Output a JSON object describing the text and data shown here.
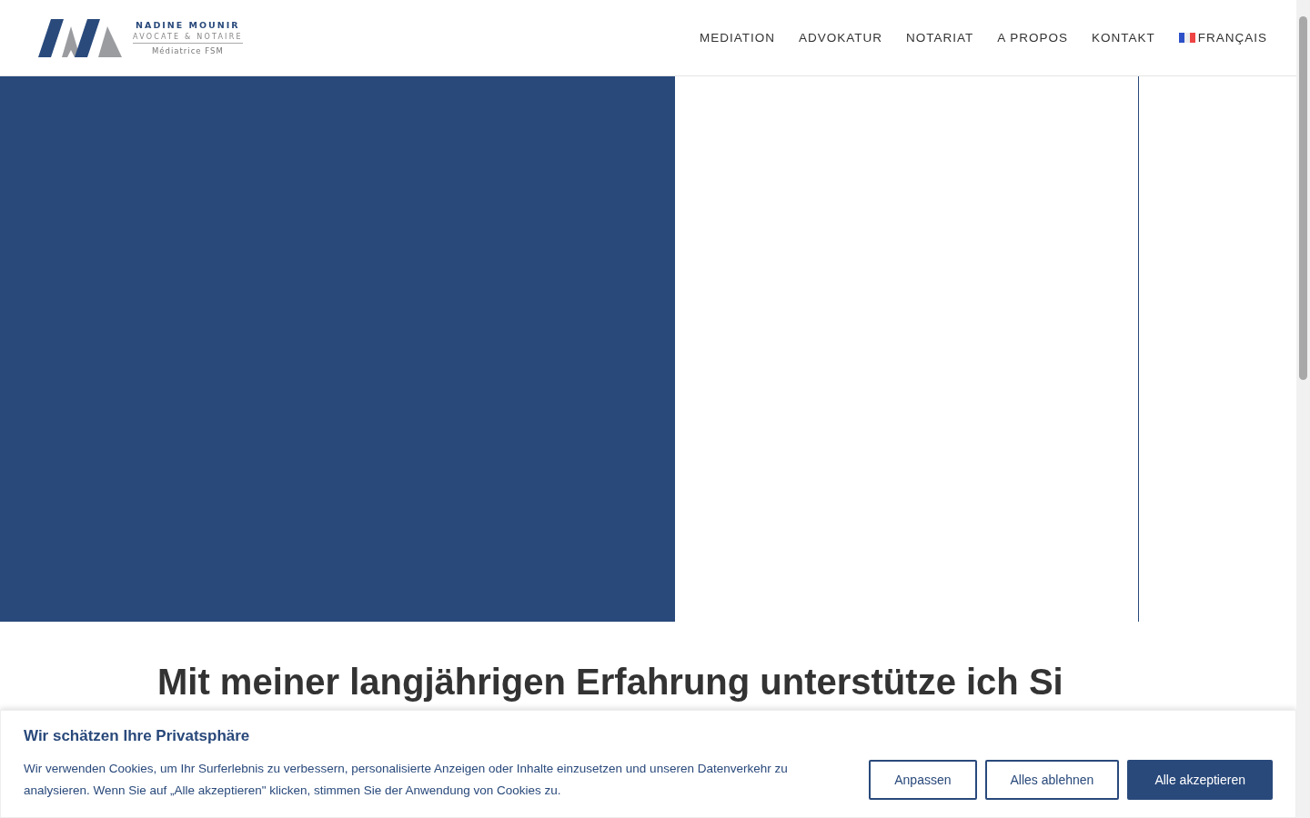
{
  "header": {
    "logo": {
      "name": "NADINE MOUNIR",
      "subtitle": "AVOCATE & NOTAIRE",
      "tagline": "Médiatrice FSM"
    },
    "nav": [
      {
        "label": "MEDIATION",
        "kind": "link"
      },
      {
        "label": "ADVOKATUR",
        "kind": "link"
      },
      {
        "label": "NOTARIAT",
        "kind": "link"
      },
      {
        "label": "A PROPOS",
        "kind": "link"
      },
      {
        "label": "KONTAKT",
        "kind": "link"
      },
      {
        "label": "FRANÇAIS",
        "kind": "language"
      }
    ]
  },
  "intro": {
    "heading": "Mit meiner langjährigen Erfahrung unterstütze ich Si"
  },
  "cookie_banner": {
    "title": "Wir schätzen Ihre Privatsphäre",
    "text": "Wir verwenden Cookies, um Ihr Surferlebnis zu verbessern, personalisierte Anzeigen oder Inhalte einzusetzen und unseren Datenverkehr zu analysieren. Wenn Sie auf „Alle akzeptieren\" klicken, stimmen Sie der Anwendung von Cookies zu.",
    "buttons": [
      {
        "label": "Anpassen",
        "kind": "outline"
      },
      {
        "label": "Alles ablehnen",
        "kind": "outline"
      },
      {
        "label": "Alle akzeptieren",
        "kind": "primary"
      }
    ]
  }
}
